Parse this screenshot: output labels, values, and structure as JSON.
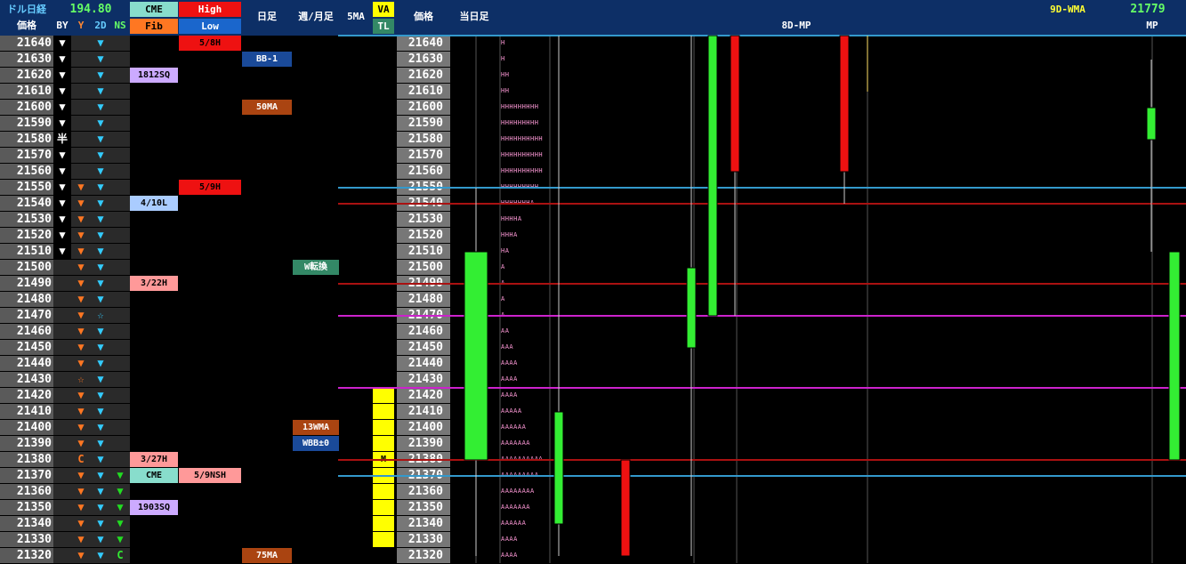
{
  "header": {
    "title": "ドル日経",
    "rate": "194.80",
    "cme_label": "CME",
    "fib_label": "Fib",
    "high_label": "High",
    "low_label": "Low",
    "price_label": "価格",
    "by_label": "BY",
    "y_label": "Y",
    "twod_label": "2D",
    "ns_label": "NS",
    "daily_label": "日足",
    "weekly_monthly_label": "週/月足",
    "fivema_label": "5MA",
    "va_label": "VA",
    "tl_label": "TL",
    "price_label2": "価格",
    "today_label": "当日足",
    "mp8d_label": "8D-MP",
    "wma9d_label": "9D-WMA",
    "wma9d_value": "21779",
    "mp_label": "MP"
  },
  "colors": {
    "bg": "#000000",
    "header": "#0d2f66",
    "up_candle": "#33ee33",
    "down_candle": "#ee1111",
    "cyan_line": "#3399cc",
    "red_line": "#aa1111",
    "magenta_line": "#cc22cc",
    "va_yellow": "#ffff00",
    "tpo_pink": "#ff9ad8"
  },
  "rows": [
    {
      "price": "21640",
      "by": "white-down",
      "y": "",
      "twod": "cyan-down",
      "ns": "",
      "cme": "",
      "high": {
        "text": "5/8H",
        "bg": "#ee1111",
        "fg": "#000000"
      },
      "daily": "",
      "weekly": "",
      "va": false,
      "price2": "21640",
      "tpo": "H"
    },
    {
      "price": "21630",
      "by": "white-down",
      "y": "",
      "twod": "cyan-down",
      "ns": "",
      "cme": "",
      "high": null,
      "daily": {
        "text": "BB-1",
        "bg": "#1a4a99",
        "fg": "#ffffff"
      },
      "weekly": "",
      "va": false,
      "price2": "21630",
      "tpo": "H"
    },
    {
      "price": "21620",
      "by": "white-down",
      "y": "",
      "twod": "cyan-down",
      "ns": "",
      "cme": {
        "text": "1812SQ",
        "bg": "#ccaaff",
        "fg": "#000000"
      },
      "high": null,
      "daily": "",
      "weekly": "",
      "va": false,
      "price2": "21620",
      "tpo": "HH"
    },
    {
      "price": "21610",
      "by": "white-down",
      "y": "",
      "twod": "cyan-down",
      "ns": "",
      "cme": "",
      "high": null,
      "daily": "",
      "weekly": "",
      "va": false,
      "price2": "21610",
      "tpo": "HH"
    },
    {
      "price": "21600",
      "by": "white-down",
      "y": "",
      "twod": "cyan-down",
      "ns": "",
      "cme": "",
      "high": null,
      "daily": {
        "text": "50MA",
        "bg": "#aa4411",
        "fg": "#ffffff"
      },
      "weekly": "",
      "va": false,
      "price2": "21600",
      "tpo": "HHHHHHHHH"
    },
    {
      "price": "21590",
      "by": "white-down",
      "y": "",
      "twod": "cyan-down",
      "ns": "",
      "cme": "",
      "high": null,
      "daily": "",
      "weekly": "",
      "va": false,
      "price2": "21590",
      "tpo": "HHHHHHHHH"
    },
    {
      "price": "21580",
      "by": "半",
      "y": "",
      "twod": "cyan-down",
      "ns": "",
      "cme": "",
      "high": null,
      "daily": "",
      "weekly": "",
      "va": false,
      "price2": "21580",
      "tpo": "HHHHHHHHHH"
    },
    {
      "price": "21570",
      "by": "white-down",
      "y": "",
      "twod": "cyan-down",
      "ns": "",
      "cme": "",
      "high": null,
      "daily": "",
      "weekly": "",
      "va": false,
      "price2": "21570",
      "tpo": "HHHHHHHHHH"
    },
    {
      "price": "21560",
      "by": "white-down",
      "y": "",
      "twod": "cyan-down",
      "ns": "",
      "cme": "",
      "high": null,
      "daily": "",
      "weekly": "",
      "va": false,
      "price2": "21560",
      "tpo": "HHHHHHHHHH"
    },
    {
      "price": "21550",
      "by": "white-down",
      "y": "orange-down",
      "twod": "cyan-down",
      "ns": "",
      "cme": "",
      "high": {
        "text": "5/9H",
        "bg": "#ee1111",
        "fg": "#000000"
      },
      "daily": "",
      "weekly": "",
      "va": false,
      "price2": "21550",
      "tpo": "HHHHHHHHH"
    },
    {
      "price": "21540",
      "by": "white-down",
      "y": "orange-down",
      "twod": "cyan-down",
      "ns": "",
      "cme": {
        "text": "4/10L",
        "bg": "#aaccff",
        "fg": "#000000"
      },
      "high": null,
      "daily": "",
      "weekly": "",
      "va": false,
      "price2": "21540",
      "tpo": "HHHHHHHA"
    },
    {
      "price": "21530",
      "by": "white-down",
      "y": "orange-down",
      "twod": "cyan-down",
      "ns": "",
      "cme": "",
      "high": null,
      "daily": "",
      "weekly": "",
      "va": false,
      "price2": "21530",
      "tpo": "HHHHA"
    },
    {
      "price": "21520",
      "by": "white-down",
      "y": "orange-down",
      "twod": "cyan-down",
      "ns": "",
      "cme": "",
      "high": null,
      "daily": "",
      "weekly": "",
      "va": false,
      "price2": "21520",
      "tpo": "HHHA"
    },
    {
      "price": "21510",
      "by": "white-down",
      "y": "orange-down",
      "twod": "cyan-down",
      "ns": "",
      "cme": "",
      "high": null,
      "daily": "",
      "weekly": "",
      "va": false,
      "price2": "21510",
      "tpo": "HA"
    },
    {
      "price": "21500",
      "by": "",
      "y": "orange-down",
      "twod": "cyan-down",
      "ns": "",
      "cme": "",
      "high": null,
      "daily": "",
      "weekly": {
        "text": "W転換",
        "bg": "#338866",
        "fg": "#ffffff"
      },
      "va": false,
      "price2": "21500",
      "tpo": "A"
    },
    {
      "price": "21490",
      "by": "",
      "y": "orange-down",
      "twod": "cyan-down",
      "ns": "",
      "cme": {
        "text": "3/22H",
        "bg": "#ff9999",
        "fg": "#000000"
      },
      "high": null,
      "daily": "",
      "weekly": "",
      "va": false,
      "price2": "21490",
      "tpo": "A"
    },
    {
      "price": "21480",
      "by": "",
      "y": "orange-down",
      "twod": "cyan-down",
      "ns": "",
      "cme": "",
      "high": null,
      "daily": "",
      "weekly": "",
      "va": false,
      "price2": "21480",
      "tpo": "A"
    },
    {
      "price": "21470",
      "by": "",
      "y": "orange-down",
      "twod": "cyan-star",
      "ns": "",
      "cme": "",
      "high": null,
      "daily": "",
      "weekly": "",
      "va": false,
      "price2": "21470",
      "tpo": "A"
    },
    {
      "price": "21460",
      "by": "",
      "y": "orange-down",
      "twod": "cyan-down",
      "ns": "",
      "cme": "",
      "high": null,
      "daily": "",
      "weekly": "",
      "va": false,
      "price2": "21460",
      "tpo": "AA"
    },
    {
      "price": "21450",
      "by": "",
      "y": "orange-down",
      "twod": "cyan-down",
      "ns": "",
      "cme": "",
      "high": null,
      "daily": "",
      "weekly": "",
      "va": false,
      "price2": "21450",
      "tpo": "AAA"
    },
    {
      "price": "21440",
      "by": "",
      "y": "orange-down",
      "twod": "cyan-down",
      "ns": "",
      "cme": "",
      "high": null,
      "daily": "",
      "weekly": "",
      "va": false,
      "price2": "21440",
      "tpo": "AAAA"
    },
    {
      "price": "21430",
      "by": "",
      "y": "orange-star",
      "twod": "cyan-down",
      "ns": "",
      "cme": "",
      "high": null,
      "daily": "",
      "weekly": "",
      "va": false,
      "price2": "21430",
      "tpo": "AAAA"
    },
    {
      "price": "21420",
      "by": "",
      "y": "orange-down",
      "twod": "cyan-down",
      "ns": "",
      "cme": "",
      "high": null,
      "daily": "",
      "weekly": "",
      "va": true,
      "price2": "21420",
      "tpo": "AAAA"
    },
    {
      "price": "21410",
      "by": "",
      "y": "orange-down",
      "twod": "cyan-down",
      "ns": "",
      "cme": "",
      "high": null,
      "daily": "",
      "weekly": "",
      "va": true,
      "price2": "21410",
      "tpo": "AAAAA"
    },
    {
      "price": "21400",
      "by": "",
      "y": "orange-down",
      "twod": "cyan-down",
      "ns": "",
      "cme": "",
      "high": null,
      "daily": "",
      "weekly": {
        "text": "13WMA",
        "bg": "#aa4411",
        "fg": "#ffffff"
      },
      "va": true,
      "price2": "21400",
      "tpo": "AAAAAA"
    },
    {
      "price": "21390",
      "by": "",
      "y": "orange-down",
      "twod": "cyan-down",
      "ns": "",
      "cme": "",
      "high": null,
      "daily": "",
      "weekly": {
        "text": "WBB±0",
        "bg": "#1a4a99",
        "fg": "#ffffff"
      },
      "va": true,
      "price2": "21390",
      "tpo": "AAAAAAA"
    },
    {
      "price": "21380",
      "by": "",
      "y": "C",
      "twod": "cyan-down",
      "ns": "",
      "cme": {
        "text": "3/27H",
        "bg": "#ff9999",
        "fg": "#000000"
      },
      "high": null,
      "daily": "",
      "weekly": "",
      "va": true,
      "va_mark": "M",
      "price2": "21380",
      "tpo": "AAAAAAAAAA"
    },
    {
      "price": "21370",
      "by": "",
      "y": "orange-down",
      "twod": "cyan-down",
      "ns": "green-down",
      "cme": {
        "text": "CME",
        "bg": "#88ddcc",
        "fg": "#000000"
      },
      "high": {
        "text": "5/9NSH",
        "bg": "#ff9999",
        "fg": "#000000"
      },
      "daily": "",
      "weekly": "",
      "va": true,
      "price2": "21370",
      "tpo": "AAAAAAAAA"
    },
    {
      "price": "21360",
      "by": "",
      "y": "orange-down",
      "twod": "cyan-down",
      "ns": "green-down",
      "cme": "",
      "high": null,
      "daily": "",
      "weekly": "",
      "va": true,
      "price2": "21360",
      "tpo": "AAAAAAAA"
    },
    {
      "price": "21350",
      "by": "",
      "y": "orange-down",
      "twod": "cyan-down",
      "ns": "green-down",
      "cme": {
        "text": "1903SQ",
        "bg": "#ccaaff",
        "fg": "#000000"
      },
      "high": null,
      "daily": "",
      "weekly": "",
      "va": true,
      "price2": "21350",
      "tpo": "AAAAAAA"
    },
    {
      "price": "21340",
      "by": "",
      "y": "orange-down",
      "twod": "cyan-down",
      "ns": "green-down",
      "cme": "",
      "high": null,
      "daily": "",
      "weekly": "",
      "va": true,
      "price2": "21340",
      "tpo": "AAAAAA"
    },
    {
      "price": "21330",
      "by": "",
      "y": "orange-down",
      "twod": "cyan-down",
      "ns": "green-down",
      "cme": "",
      "high": null,
      "daily": "",
      "weekly": "",
      "va": true,
      "price2": "21330",
      "tpo": "AAAA"
    },
    {
      "price": "21320",
      "by": "",
      "y": "orange-down",
      "twod": "cyan-down",
      "ns": "C",
      "cme": "",
      "high": null,
      "daily": {
        "text": "75MA",
        "bg": "#aa4411",
        "fg": "#ffffff"
      },
      "weekly": "",
      "va": false,
      "price2": "21320",
      "tpo": "AAAA"
    }
  ],
  "levels": [
    {
      "price": 21640,
      "color": "cyan"
    },
    {
      "price": 21550,
      "color": "cyan"
    },
    {
      "price": 21540,
      "color": "red"
    },
    {
      "price": 21490,
      "color": "red"
    },
    {
      "price": 21470,
      "color": "magenta"
    },
    {
      "price": 21425,
      "color": "magenta"
    },
    {
      "price": 21380,
      "color": "red"
    },
    {
      "price": 21370,
      "color": "cyan"
    }
  ],
  "candles": [
    {
      "name": "today",
      "open": 21380,
      "close": 21510,
      "high": 21550,
      "low": 21320,
      "dir": "up"
    },
    {
      "name": "d1",
      "open": 21340,
      "close": 21410,
      "high": 21645,
      "low": 21320,
      "dir": "up"
    },
    {
      "name": "d2",
      "open": 21380,
      "close": 21320,
      "high": 21380,
      "low": 21320,
      "dir": "down"
    },
    {
      "name": "d3",
      "open": 21450,
      "close": 21500,
      "high": 21645,
      "low": 21320,
      "dir": "up"
    },
    {
      "name": "d4",
      "open": 21470,
      "close": 21645,
      "high": 21645,
      "low": 21470,
      "dir": "up"
    },
    {
      "name": "d5",
      "open": 21645,
      "close": 21560,
      "high": 21645,
      "low": 21470,
      "dir": "down"
    },
    {
      "name": "d6",
      "open": 21645,
      "close": 21560,
      "high": 21645,
      "low": 21540,
      "dir": "down"
    },
    {
      "name": "d7",
      "open": 21645,
      "close": 21645,
      "high": 21645,
      "low": 21610,
      "dir": "flat"
    },
    {
      "name": "d8",
      "open": 21580,
      "close": 21600,
      "high": 21630,
      "low": 21510,
      "dir": "up"
    },
    {
      "name": "mp",
      "open": 21380,
      "close": 21510,
      "high": 21510,
      "low": 21380,
      "dir": "up"
    }
  ]
}
